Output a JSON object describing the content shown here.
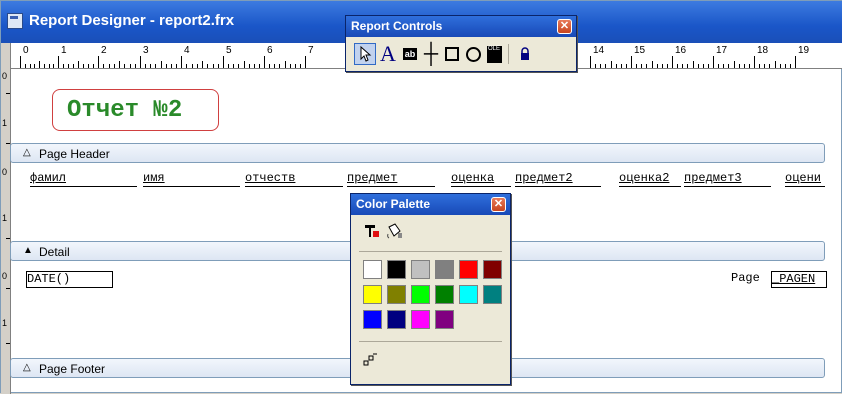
{
  "window": {
    "title": "Report Designer - report2.frx"
  },
  "ruler": {
    "numbers": [
      "0",
      "1",
      "2",
      "3",
      "4",
      "5",
      "6",
      "7",
      "14",
      "15",
      "16",
      "17",
      "18",
      "19"
    ]
  },
  "vruler": {
    "labels": [
      "0",
      "1",
      "0",
      "1",
      "0",
      "1"
    ]
  },
  "report": {
    "title_text": "Отчет №2",
    "page_header_label": "Page Header",
    "detail_label": "Detail",
    "page_footer_label": "Page Footer",
    "header_fields": [
      "фамил",
      "имя",
      "отчеств",
      "предмет",
      "оценка",
      "предмет2",
      "оценка2",
      "предмет3",
      "оцени"
    ],
    "date_field": "DATE()",
    "page_label": "Page",
    "page_field": "_PAGEN"
  },
  "report_controls": {
    "title": "Report Controls",
    "tools": [
      "pointer-icon",
      "label-icon",
      "field-icon",
      "line-icon",
      "rectangle-icon",
      "rounded-rectangle-icon",
      "picture-ole-icon",
      "lock-icon"
    ],
    "label_glyph": "A",
    "field_glyph": "ab",
    "ole_glyph": "OLE"
  },
  "color_palette": {
    "title": "Color Palette",
    "colors": [
      "#ffffff",
      "#000000",
      "#c0c0c0",
      "#808080",
      "#ff0000",
      "#800000",
      "#ffff00",
      "#808000",
      "#00ff00",
      "#008000",
      "#00ffff",
      "#008080",
      "#0000ff",
      "#000080",
      "#ff00ff",
      "#800080"
    ]
  }
}
